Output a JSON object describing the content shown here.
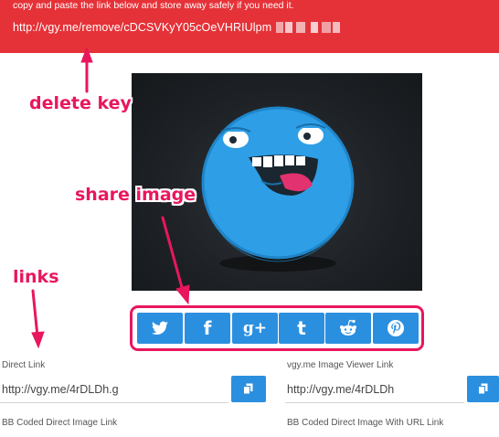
{
  "banner": {
    "note": "copy and paste the link below and store away safely if you need it.",
    "delete_url": "http://vgy.me/remove/cDCSVKyY05cOeVHRIUlpm"
  },
  "annotations": {
    "delete_key": "delete key",
    "share_image": "share image",
    "links": "links"
  },
  "share": {
    "buttons": [
      {
        "name": "twitter",
        "icon": "twitter-icon",
        "glyph": ""
      },
      {
        "name": "facebook",
        "icon": "facebook-icon",
        "glyph": "f"
      },
      {
        "name": "google-plus",
        "icon": "google-plus-icon",
        "glyph": "g+"
      },
      {
        "name": "tumblr",
        "icon": "tumblr-icon",
        "glyph": "t"
      },
      {
        "name": "reddit",
        "icon": "reddit-icon",
        "glyph": ""
      },
      {
        "name": "pinterest",
        "icon": "pinterest-icon",
        "glyph": ""
      }
    ],
    "button_color": "#2b8fe0"
  },
  "links": {
    "direct": {
      "label": "Direct Link",
      "value": "http://vgy.me/4rDLDh.g"
    },
    "viewer": {
      "label": "vgy.me Image Viewer Link",
      "value": "http://vgy.me/4rDLDh"
    },
    "bb_direct": {
      "label": "BB Coded Direct Image Link"
    },
    "bb_url": {
      "label": "BB Coded Direct Image With URL Link"
    }
  },
  "colors": {
    "banner": "#e53238",
    "annotation": "#e8175d",
    "accent": "#2b8fe0"
  }
}
